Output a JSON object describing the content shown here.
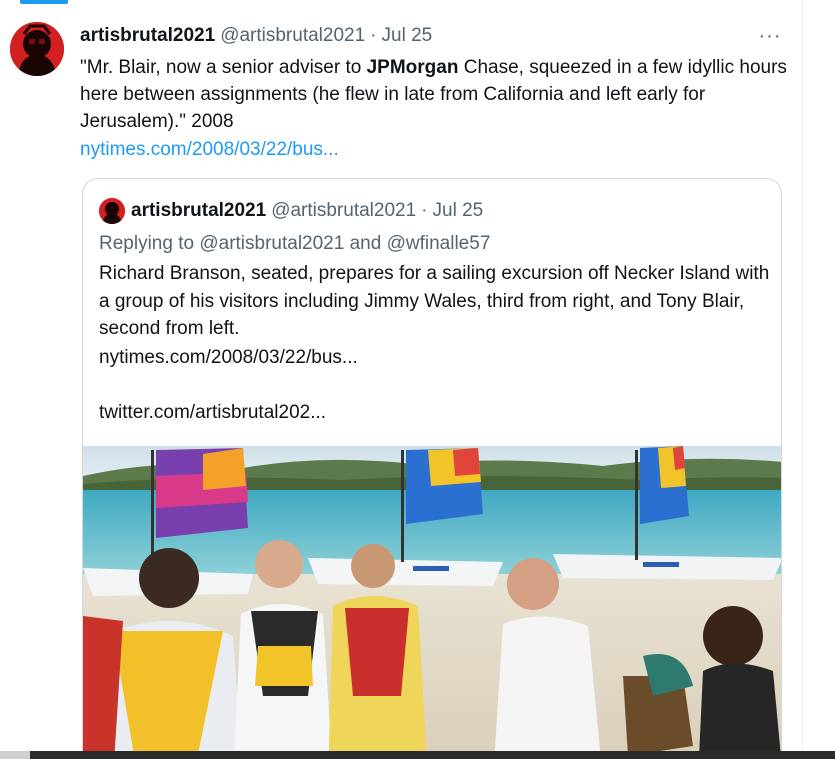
{
  "tweet": {
    "author_name": "artisbrutal2021",
    "author_handle": "@artisbrutal2021",
    "separator": "·",
    "date": "Jul 25",
    "more_label": "···",
    "text_part1": "\"Mr. Blair, now a senior adviser to ",
    "text_bold": "JPMorgan",
    "text_part2": " Chase, squeezed in a few idyllic hours here between assignments (he flew in late from California  and left early for Jerusalem).\" 2008",
    "link": "nytimes.com/2008/03/22/bus..."
  },
  "quote": {
    "author_name": "artisbrutal2021",
    "author_handle": "@artisbrutal2021",
    "separator": "·",
    "date": "Jul 25",
    "replying_prefix": "Replying to ",
    "replying_user1": "@artisbrutal2021",
    "replying_and": " and ",
    "replying_user2": "@wfinalle57",
    "text": "Richard Branson,  seated, prepares for a sailing excursion off Necker Island with a group  of his visitors including Jimmy Wales, third from right, and Tony Blair,  second from left.",
    "link1": "nytimes.com/2008/03/22/bus...",
    "link2": "twitter.com/artisbrutal202..."
  },
  "colors": {
    "accent": "#1d9bf0",
    "text_primary": "#0f1419",
    "text_secondary": "#536471",
    "border": "#cfd9de",
    "avatar_red": "#d21f1f"
  },
  "icons": {
    "more": "more-horizontal-icon",
    "avatar": "user-avatar"
  }
}
